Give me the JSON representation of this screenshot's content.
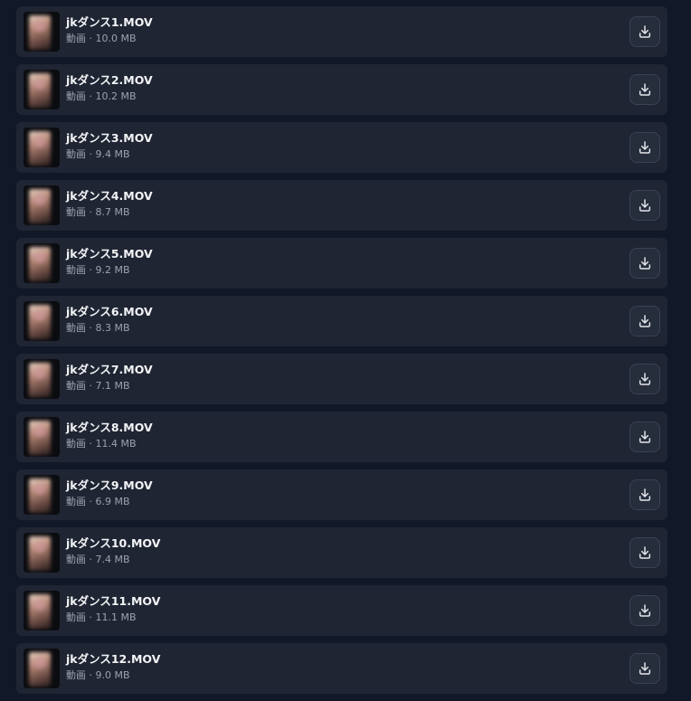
{
  "files": [
    {
      "name": "jkダンス1.MOV",
      "meta": "動画 · 10.0 MB"
    },
    {
      "name": "jkダンス2.MOV",
      "meta": "動画 · 10.2 MB"
    },
    {
      "name": "jkダンス3.MOV",
      "meta": "動画 · 9.4 MB"
    },
    {
      "name": "jkダンス4.MOV",
      "meta": "動画 · 8.7 MB"
    },
    {
      "name": "jkダンス5.MOV",
      "meta": "動画 · 9.2 MB"
    },
    {
      "name": "jkダンス6.MOV",
      "meta": "動画 · 8.3 MB"
    },
    {
      "name": "jkダンス7.MOV",
      "meta": "動画 · 7.1 MB"
    },
    {
      "name": "jkダンス8.MOV",
      "meta": "動画 · 11.4 MB"
    },
    {
      "name": "jkダンス9.MOV",
      "meta": "動画 · 6.9 MB"
    },
    {
      "name": "jkダンス10.MOV",
      "meta": "動画 · 7.4 MB"
    },
    {
      "name": "jkダンス11.MOV",
      "meta": "動画 · 11.1 MB"
    },
    {
      "name": "jkダンス12.MOV",
      "meta": "動画 · 9.0 MB"
    }
  ],
  "icons": {
    "thumbnail": "video-thumbnail-icon",
    "download": "download-icon"
  },
  "colors": {
    "background": "#111827",
    "row": "#1f2532",
    "title": "#f3f4f6",
    "meta": "#9ca3af",
    "button_border": "#3a4254"
  }
}
